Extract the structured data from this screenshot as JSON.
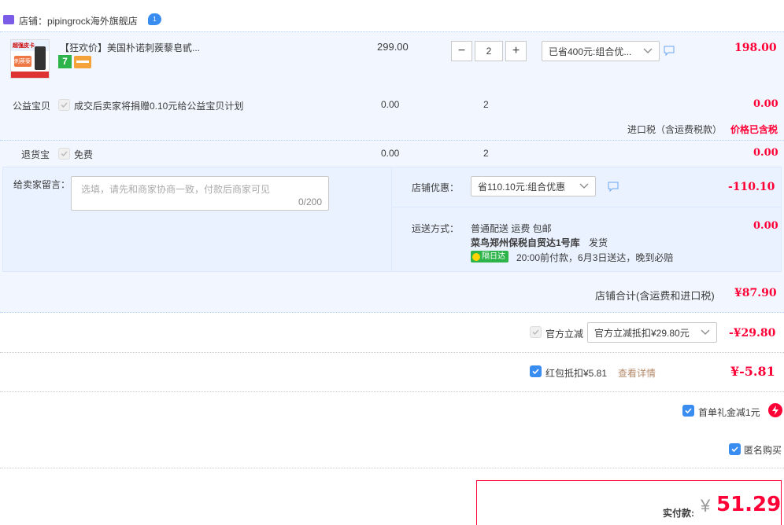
{
  "shop": {
    "label": "店铺：pipingrock海外旗舰店",
    "badge": "1"
  },
  "product": {
    "title": "【狂欢价】美国朴诺刺蒺藜皂甙...",
    "thumb_text_top": "超强皮卡",
    "thumb_text_mid": "刺蒺藜",
    "badge_seven": "7",
    "unit_price": "299.00",
    "qty": "2",
    "minus": "−",
    "plus": "+",
    "promo_select": "已省400元:组合优...",
    "total": "198.00"
  },
  "charity": {
    "label": "公益宝贝",
    "text": "成交后卖家将捐赠0.10元给公益宝贝计划",
    "price": "0.00",
    "qty": "2",
    "total": "0.00"
  },
  "tax": {
    "label": "进口税（含运费税款）",
    "value": "价格已含税"
  },
  "return_ins": {
    "label": "退货宝",
    "text": "免费",
    "price": "0.00",
    "qty": "2",
    "total": "0.00"
  },
  "message": {
    "label": "给卖家留言：",
    "placeholder": "选填，请先和商家协商一致，付款后商家可见",
    "counter": "0/200"
  },
  "store_discount": {
    "label": "店铺优惠：",
    "select": "省110.10元:组合优惠",
    "amount": "-110.10"
  },
  "shipping": {
    "label": "运送方式：",
    "line1": "普通配送 运费 包邮",
    "line2_bold": "菜鸟郑州保税自贸达1号库",
    "line2_tail": "发货",
    "tag": "隔日达",
    "line3": "20:00前付款，6月3日送达，晚到必赔",
    "amount": "0.00"
  },
  "store_total": {
    "label": "店铺合计(含运费和进口税)",
    "value": "¥87.90"
  },
  "official": {
    "label": "官方立减",
    "select": "官方立减抵扣¥29.80元",
    "amount": "-¥29.80"
  },
  "red_packet": {
    "label": "红包抵扣¥5.81",
    "link": "查看详情",
    "amount": "¥-5.81"
  },
  "first_order": {
    "label": "首单礼金减1元"
  },
  "anonymous": {
    "label": "匿名购买"
  },
  "pay": {
    "label": "实付款:",
    "currency": "¥",
    "amount": "51.29"
  },
  "colors": {
    "accent_red": "#ff0036",
    "blue": "#3a8df0",
    "row_bg": "#f2f7ff",
    "border_dash": "#b2d1ff"
  }
}
